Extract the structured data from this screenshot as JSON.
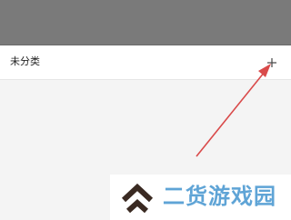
{
  "header": {
    "background_color": "#7a7a7a"
  },
  "category_row": {
    "label": "未分类",
    "add_icon": "plus-icon"
  },
  "annotation": {
    "arrow_color": "#d94a4a",
    "target": "add-button"
  },
  "watermark": {
    "text": "二货游戏园",
    "logo_icon": "double-chevron-up-logo",
    "text_color": "#5fa4d6",
    "logo_color": "#3a2a22"
  }
}
